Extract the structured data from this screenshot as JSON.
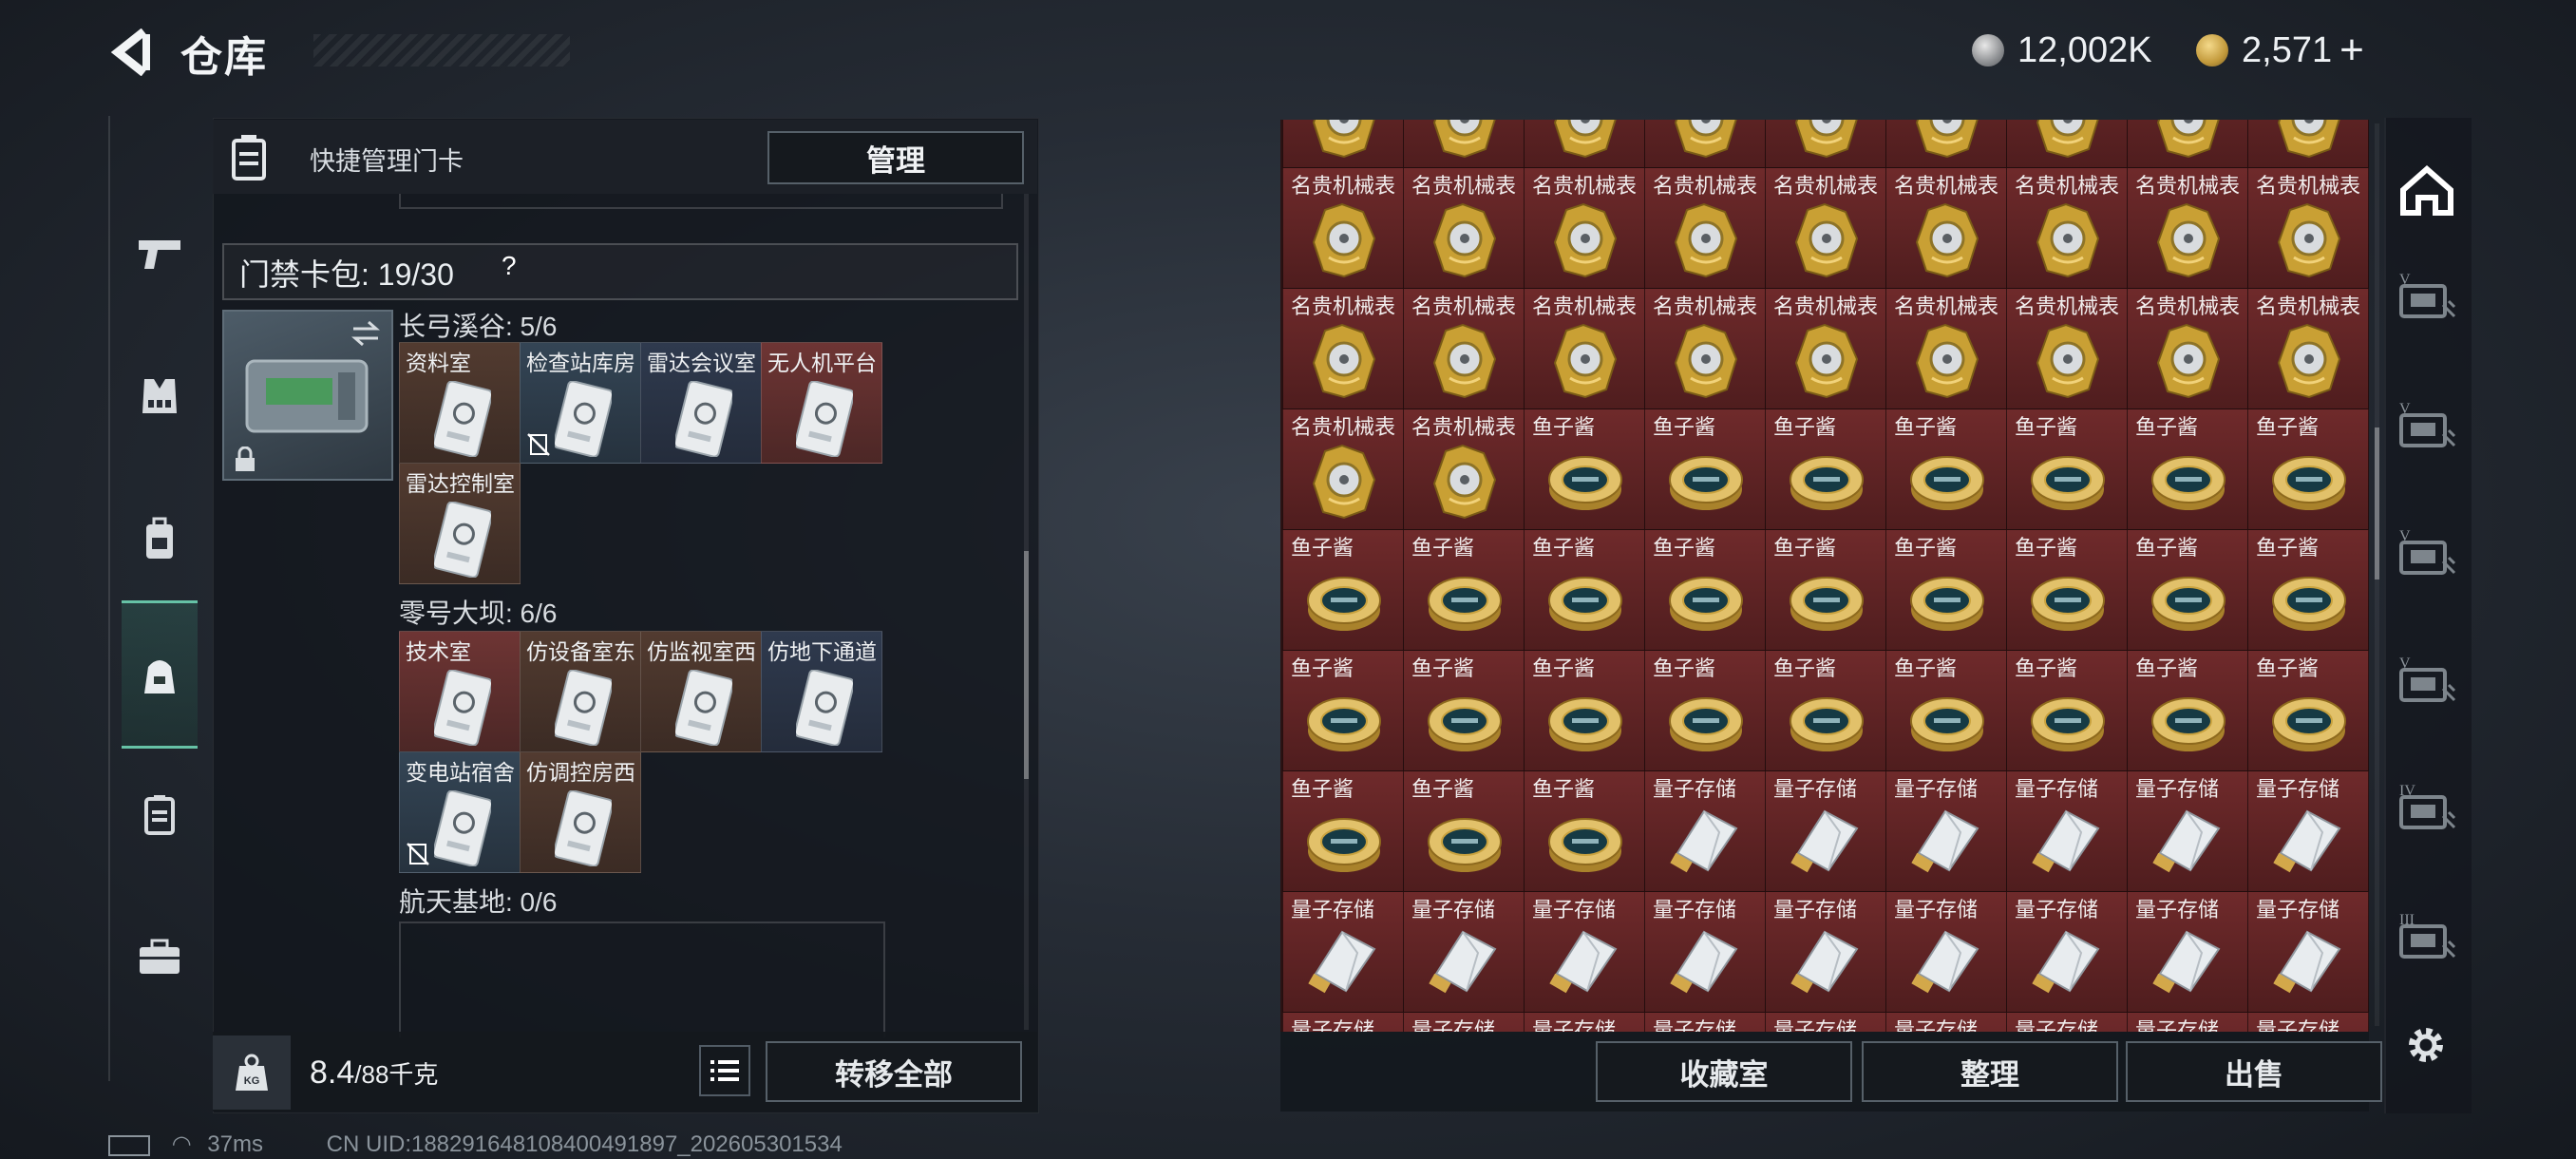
{
  "header": {
    "title": "仓库",
    "currency_a": "12,002K",
    "currency_b": "2,571",
    "plus": "+"
  },
  "quick_manage": {
    "label": "快捷管理门卡",
    "button": "管理"
  },
  "card_pack": {
    "label": "门禁卡包: 19/30",
    "help": "?"
  },
  "sections": [
    {
      "title": "长弓溪谷: 5/6",
      "cards": [
        {
          "label": "资料室",
          "color": "brown",
          "disabled": false
        },
        {
          "label": "检查站库房",
          "color": "slate",
          "disabled": true
        },
        {
          "label": "雷达会议室",
          "color": "navy",
          "disabled": false
        },
        {
          "label": "无人机平台",
          "color": "red",
          "disabled": false
        },
        {
          "label": "雷达控制室",
          "color": "brown",
          "disabled": false
        }
      ]
    },
    {
      "title": "零号大坝: 6/6",
      "cards": [
        {
          "label": "技术室",
          "color": "red",
          "disabled": false
        },
        {
          "label": "仿设备室东",
          "color": "brown",
          "disabled": false
        },
        {
          "label": "仿监视室西",
          "color": "brown",
          "disabled": false
        },
        {
          "label": "仿地下通道",
          "color": "navy",
          "disabled": false
        },
        {
          "label": "变电站宿舍",
          "color": "slate",
          "disabled": true
        },
        {
          "label": "仿调控房西",
          "color": "brown",
          "disabled": false
        }
      ]
    },
    {
      "title": "航天基地: 0/6",
      "cards": []
    }
  ],
  "weight": {
    "value": "8.4",
    "total": "/88千克",
    "kg": "KG"
  },
  "buttons": {
    "transfer_all": "转移全部",
    "collection": "收藏室",
    "sort": "整理",
    "sell": "出售"
  },
  "status": {
    "latency": "37ms",
    "uid": "CN UID:188291648108400491897_202605301534"
  },
  "grid": {
    "rows": [
      [
        "名贵机械表",
        "名贵机械表",
        "名贵机械表",
        "名贵机械表",
        "名贵机械表",
        "名贵机械表",
        "名贵机械表",
        "名贵机械表",
        "名贵机械表"
      ],
      [
        "名贵机械表",
        "名贵机械表",
        "名贵机械表",
        "名贵机械表",
        "名贵机械表",
        "名贵机械表",
        "名贵机械表",
        "名贵机械表",
        "名贵机械表"
      ],
      [
        "名贵机械表",
        "名贵机械表",
        "鱼子酱",
        "鱼子酱",
        "鱼子酱",
        "鱼子酱",
        "鱼子酱",
        "鱼子酱",
        "鱼子酱"
      ],
      [
        "鱼子酱",
        "鱼子酱",
        "鱼子酱",
        "鱼子酱",
        "鱼子酱",
        "鱼子酱",
        "鱼子酱",
        "鱼子酱",
        "鱼子酱"
      ],
      [
        "鱼子酱",
        "鱼子酱",
        "鱼子酱",
        "鱼子酱",
        "鱼子酱",
        "鱼子酱",
        "鱼子酱",
        "鱼子酱",
        "鱼子酱"
      ],
      [
        "鱼子酱",
        "鱼子酱",
        "鱼子酱",
        "量子存储",
        "量子存储",
        "量子存储",
        "量子存储",
        "量子存储",
        "量子存储"
      ],
      [
        "量子存储",
        "量子存储",
        "量子存储",
        "量子存储",
        "量子存储",
        "量子存储",
        "量子存储",
        "量子存储",
        "量子存储"
      ],
      [
        "量子存储",
        "量子存储",
        "量子存储",
        "量子存储",
        "量子存储",
        "量子存储",
        "量子存储",
        "量子存储",
        "量子存储"
      ]
    ]
  },
  "right_tabs": [
    "home-icon",
    "keycard-v-icon",
    "keycard-v-icon",
    "keycard-v-icon",
    "keycard-v-icon",
    "keycard-iv-icon",
    "keycard-iii-icon",
    "settings-icon"
  ]
}
